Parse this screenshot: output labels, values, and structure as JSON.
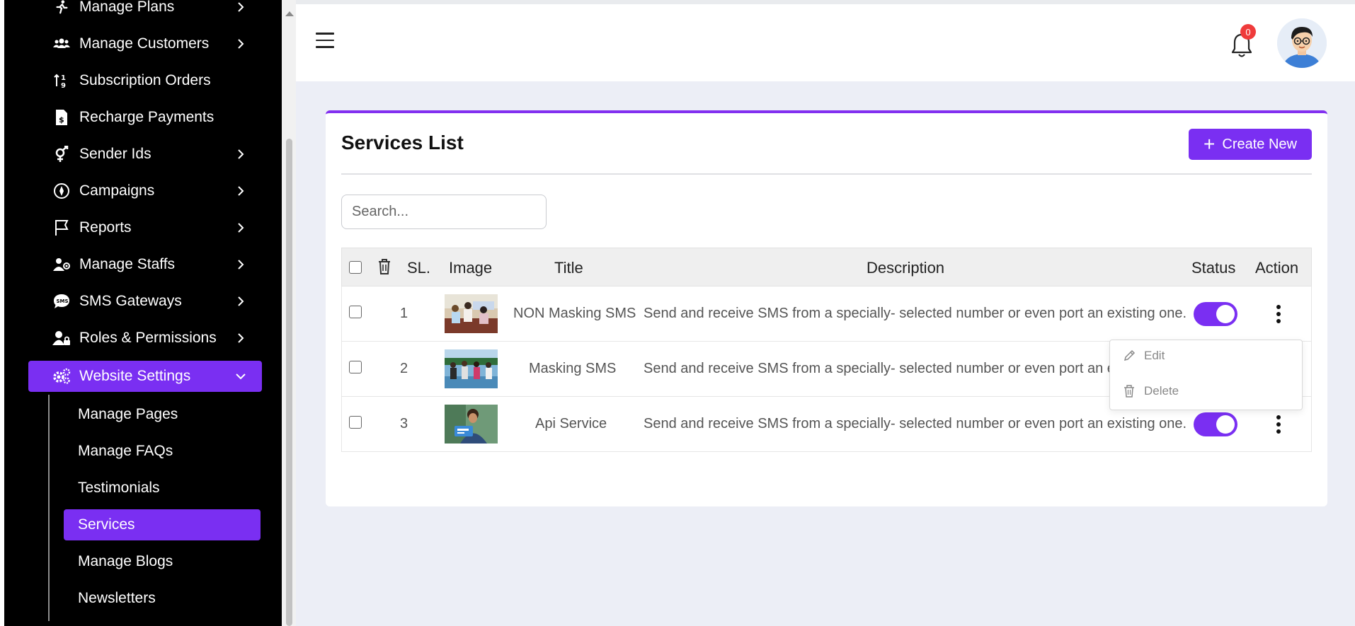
{
  "sidebar": {
    "items": [
      {
        "label": "Manage Plans",
        "icon": "run-icon",
        "has_chevron": true
      },
      {
        "label": "Manage Customers",
        "icon": "users-icon",
        "has_chevron": true
      },
      {
        "label": "Subscription Orders",
        "icon": "sort-icon",
        "has_chevron": false
      },
      {
        "label": "Recharge Payments",
        "icon": "invoice-icon",
        "has_chevron": false
      },
      {
        "label": "Sender Ids",
        "icon": "gender-icon",
        "has_chevron": true
      },
      {
        "label": "Campaigns",
        "icon": "compass-icon",
        "has_chevron": true
      },
      {
        "label": "Reports",
        "icon": "flag-icon",
        "has_chevron": true
      },
      {
        "label": "Manage Staffs",
        "icon": "staff-icon",
        "has_chevron": true
      },
      {
        "label": "SMS Gateways",
        "icon": "sms-icon",
        "has_chevron": true
      },
      {
        "label": "Roles & Permissions",
        "icon": "user-lock-icon",
        "has_chevron": true
      },
      {
        "label": "Website Settings",
        "icon": "cogs-icon",
        "has_chevron": true,
        "active": true
      }
    ],
    "sub_items": [
      {
        "label": "Manage Pages"
      },
      {
        "label": "Manage FAQs"
      },
      {
        "label": "Testimonials"
      },
      {
        "label": "Services",
        "active": true
      },
      {
        "label": "Manage Blogs"
      },
      {
        "label": "Newsletters"
      }
    ]
  },
  "header": {
    "notification_count": "0"
  },
  "main": {
    "title": "Services List",
    "create_label": "Create New",
    "search_placeholder": "Search...",
    "columns": {
      "sl": "SL.",
      "image": "Image",
      "title": "Title",
      "description": "Description",
      "status": "Status",
      "action": "Action"
    },
    "rows": [
      {
        "sl": "1",
        "title": "NON Masking SMS",
        "description": "Send and receive SMS from a specially- selected number or even port an existing one.",
        "status": true
      },
      {
        "sl": "2",
        "title": "Masking SMS",
        "description": "Send and receive SMS from a specially- selected number or even port an existing one.",
        "status": true
      },
      {
        "sl": "3",
        "title": "Api Service",
        "description": "Send and receive SMS from a specially- selected number or even port an existing one.",
        "status": true
      }
    ],
    "dropdown": {
      "edit_label": "Edit",
      "delete_label": "Delete"
    }
  },
  "colors": {
    "accent": "#7a2ff2",
    "badge": "#ef3b3b",
    "content_bg": "#eceef6"
  }
}
